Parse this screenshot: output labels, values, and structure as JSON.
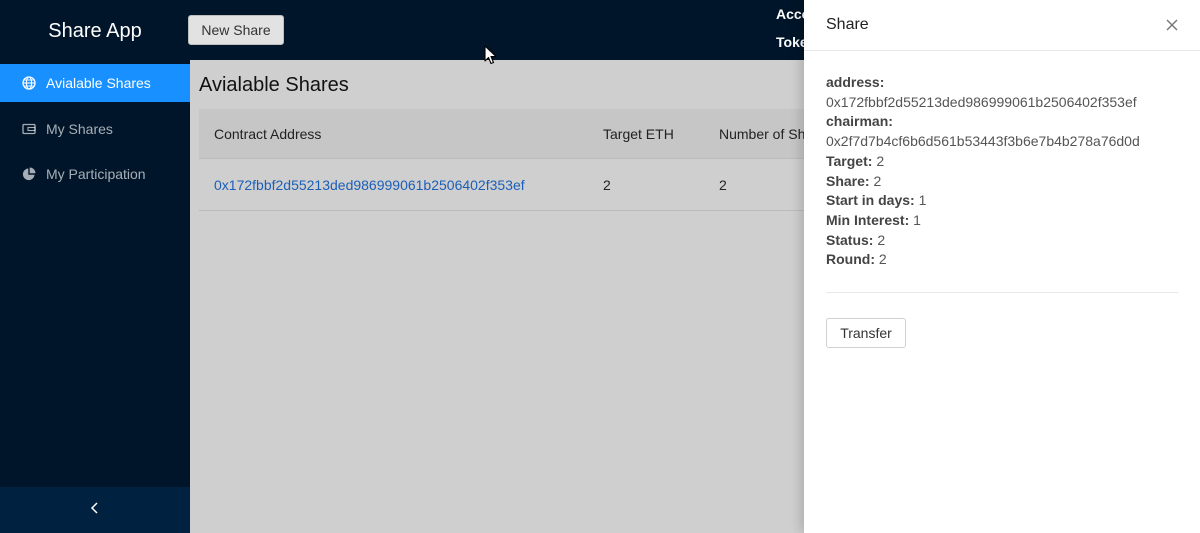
{
  "app": {
    "title": "Share App",
    "new_share_label": "New Share"
  },
  "header": {
    "account_label": "Acco",
    "token_label": "Toke"
  },
  "sidebar": {
    "items": [
      {
        "label": "Avialable Shares",
        "icon": "globe-icon",
        "active": true
      },
      {
        "label": "My Shares",
        "icon": "wallet-icon",
        "active": false
      },
      {
        "label": "My Participation",
        "icon": "pie-chart-icon",
        "active": false
      }
    ],
    "collapse_glyph": "<"
  },
  "main": {
    "title": "Avialable Shares",
    "columns": [
      "Contract Address",
      "Target ETH",
      "Number of Sh"
    ],
    "rows": [
      [
        "0x172fbbf2d55213ded986999061b2506402f353ef",
        "2",
        "2"
      ]
    ]
  },
  "drawer": {
    "title": "Share",
    "fields": [
      {
        "label": "address:",
        "value": "0x172fbbf2d55213ded986999061b2506402f353ef"
      },
      {
        "label": "chairman:",
        "value": "0x2f7d7b4cf6b6d561b53443f3b6e7b4b278a76d0d"
      },
      {
        "label": "Target:",
        "value": "2"
      },
      {
        "label": "Share:",
        "value": "2"
      },
      {
        "label": "Start in days:",
        "value": "1"
      },
      {
        "label": "Min Interest:",
        "value": "1"
      },
      {
        "label": "Status:",
        "value": "2"
      },
      {
        "label": "Round:",
        "value": "2"
      }
    ],
    "transfer_label": "Transfer"
  },
  "colors": {
    "sidebar_bg": "#001529",
    "accent": "#1890ff",
    "link": "#1c5fb8",
    "overlay": "#cfcfcf"
  }
}
